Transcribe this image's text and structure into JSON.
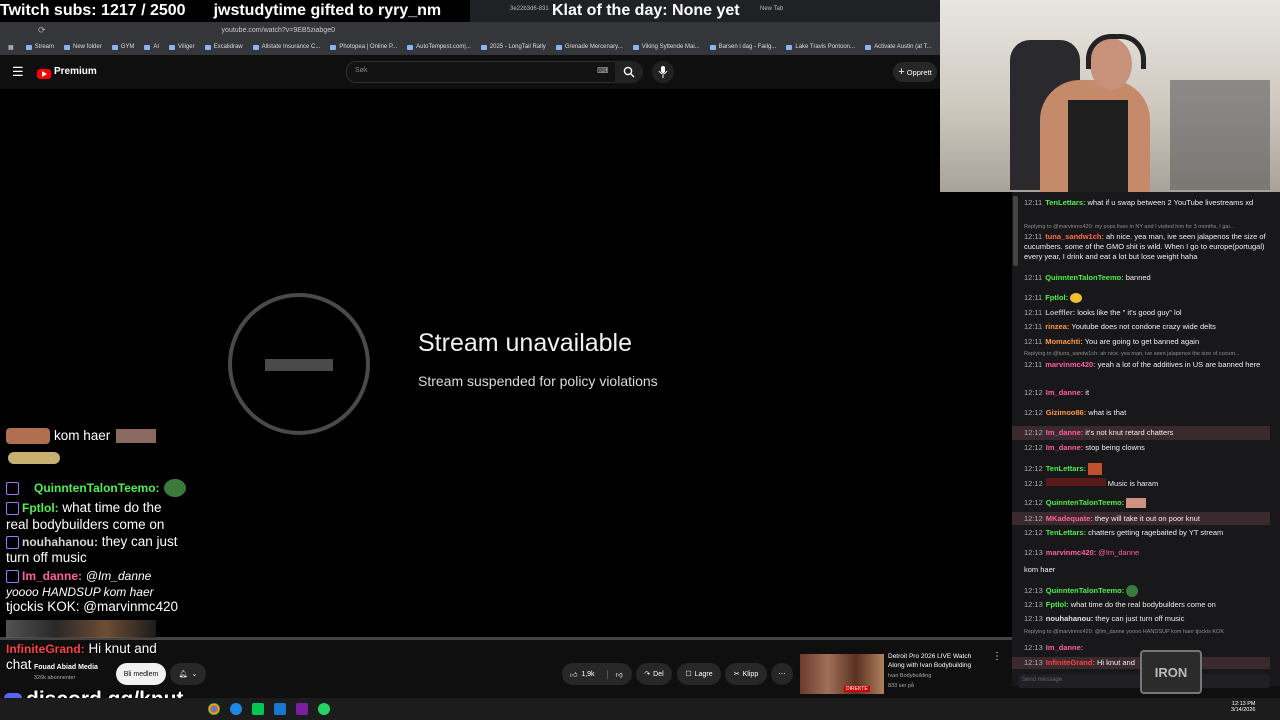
{
  "overlay": {
    "subs": "Twitch subs: 1217 / 2500",
    "gifted": "jwstudytime gifted to ryry_nm",
    "klat": "Klat of the day: None yet",
    "discord": "discord.gg/knut"
  },
  "browser": {
    "tabs": [
      "3e22b3d6-831",
      "New Tab"
    ],
    "url": "youtube.com/watch?v=9EB5ziabge0",
    "bookmarks": [
      "Stream",
      "New folder",
      "GYM",
      "AI",
      "Viliger",
      "Excalidraw",
      "Allstate Insurance C...",
      "Photopea | Online P...",
      "AutoTempest.com|...",
      "2025 - LongTail Rally",
      "Grenade Mercenary...",
      "Viking Syttende Mai...",
      "Barsen i dag - Fælg...",
      "Lake Travis Pontoon...",
      "Activate Austin (at T..."
    ]
  },
  "youtube": {
    "premium_label": "Premium",
    "search_placeholder": "Søk",
    "create_label": "Opprett",
    "unavailable_title": "Stream unavailable",
    "unavailable_sub": "Stream suspended for policy violations",
    "channel_name": "Fouad Abiad Media",
    "subscribers": "326k abonnenter",
    "join_label": "Bli medlem",
    "likes": "1,9k",
    "share_label": "Del",
    "save_label": "Lagre",
    "clip_label": "Klipp",
    "rec_title": "Detroit Pro 2026 LIVE Watch Along with Ivan Bodybuilding",
    "rec_channel": "Ivan Bodybuilding",
    "rec_viewers": "833 ser på",
    "rec_live": "DIREKTE"
  },
  "overlay_chat": [
    {
      "name": "",
      "text": "kom haer",
      "color": "#ffffff"
    },
    {
      "name": "QuinntenTalonTeemo:",
      "text": "",
      "color": "#4cf04c"
    },
    {
      "name": "Fptlol:",
      "text": "what time do the",
      "color": "#4cf04c"
    },
    {
      "name": "",
      "text": "real bodybuilders come on",
      "color": "#ffffff"
    },
    {
      "name": "nouhahanou:",
      "text": "they can just",
      "color": "#d6d6d6"
    },
    {
      "name": "",
      "text": "turn off music",
      "color": "#ffffff"
    },
    {
      "name": "Im_danne:",
      "text": "@Im_danne",
      "color": "#ff5fa2"
    },
    {
      "name": "",
      "text": "yoooo HANDSUP kom haer",
      "color": "#ffffff"
    },
    {
      "name": "",
      "text": "tjockis KOK:  @marvinmc420",
      "color": "#ffffff"
    },
    {
      "name": "InfiniteGrand:",
      "text": "Hi knut and",
      "color": "#ff4040"
    },
    {
      "name": "",
      "text": "chat",
      "color": "#ffffff"
    }
  ],
  "chat": {
    "input_placeholder": "Send message",
    "messages": [
      {
        "time": "12:11",
        "name": "TenLettars:",
        "text": "what if u swap between 2 YouTube livestreams xd",
        "color": "#4cf04c"
      },
      {
        "reply": "Replying to @marvinmc420: my pops lives in NY and I visited him for 3 months, I gai..."
      },
      {
        "time": "12:11",
        "name": "tuna_sandw1ch:",
        "text": "ah nice. yea man, ive seen jalapenos the size of cucumbers. some of the GMO shit is wild. When I go to europe(portugal) every year, I drink and eat a lot but lose weight haha",
        "color": "#ff6a4d"
      },
      {
        "time": "12:11",
        "name": "QuinntenTalonTeemo:",
        "text": "banned",
        "color": "#4cf04c"
      },
      {
        "time": "12:11",
        "name": "Fptlol:",
        "text": "",
        "color": "#4cf04c"
      },
      {
        "time": "12:11",
        "name": "Loeffler:",
        "text": "looks like the \" it's good guy\" lol",
        "color": "#b0b0b0"
      },
      {
        "time": "12:11",
        "name": "rinzea:",
        "text": "Youtube does not condone crazy wide delts",
        "color": "#ff9a3c"
      },
      {
        "time": "12:11",
        "name": "Momachti:",
        "text": "You are going to get banned again",
        "color": "#ff9a3c"
      },
      {
        "reply": "Replying to @tuna_sandw1ch: ah nice. yea man, ive seen jalapenos the size of cucum..."
      },
      {
        "time": "12:11",
        "name": "marvinmc420:",
        "text": "yeah a lot of the additives in US are banned here",
        "color": "#ff5fa2"
      },
      {
        "time": "12:12",
        "name": "Im_danne:",
        "text": "it",
        "color": "#ff5fa2"
      },
      {
        "time": "12:12",
        "name": "Gizimoo86:",
        "text": "what is that",
        "color": "#ff9a3c"
      },
      {
        "time": "12:12",
        "name": "Im_danne:",
        "text": "it's not knut  retard  chatters",
        "color": "#ff5fa2"
      },
      {
        "time": "12:12",
        "name": "Im_danne:",
        "text": "stop being clowns",
        "color": "#ff5fa2"
      },
      {
        "time": "12:12",
        "name": "TenLettars:",
        "text": "",
        "color": "#4cf04c"
      },
      {
        "time": "12:12",
        "name": "",
        "text": "Music is haram",
        "color": "#ff3333"
      },
      {
        "time": "12:12",
        "name": "QuinntenTalonTeemo:",
        "text": "",
        "color": "#4cf04c"
      },
      {
        "time": "12:12",
        "name": "MKadequate:",
        "text": "they will take it out on poor knut",
        "color": "#ff5fa2"
      },
      {
        "time": "12:12",
        "name": "TenLettars:",
        "text": "chatters getting ragebaited by YT stream",
        "color": "#4cf04c"
      },
      {
        "time": "12:13",
        "name": "marvinmc420:",
        "text": "@Im_danne",
        "color": "#ff5fa2"
      },
      {
        "time": "",
        "name": "",
        "text": "kom haer",
        "color": "#efeff1"
      },
      {
        "time": "12:13",
        "name": "QuinntenTalonTeemo:",
        "text": "",
        "color": "#4cf04c"
      },
      {
        "time": "12:13",
        "name": "Fptlol:",
        "text": "what time do the real bodybuilders come on",
        "color": "#4cf04c"
      },
      {
        "time": "12:13",
        "name": "nouhahanou:",
        "text": "they can just turn off music",
        "color": "#e0e0e0"
      },
      {
        "reply": "Replying to @marvinmc420: @Im_danne yoooo HANDSUP kom haer tjockis KOK"
      },
      {
        "time": "12:13",
        "name": "Im_danne:",
        "text": "",
        "color": "#ff5fa2"
      },
      {
        "time": "12:13",
        "name": "InfiniteGrand:",
        "text": "Hi knut and",
        "color": "#ff4040"
      }
    ]
  },
  "taskbar": {
    "time": "12:13 PM",
    "date": "3/14/2026"
  },
  "colors": {
    "accent_red": "#ff0000",
    "twitch_purple": "#a970ff"
  }
}
